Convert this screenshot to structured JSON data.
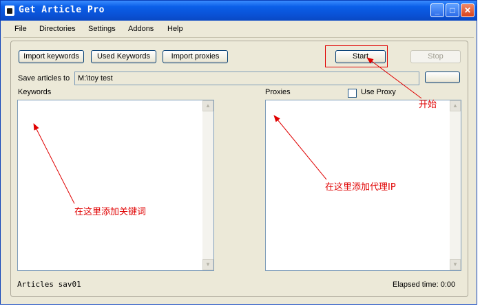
{
  "window": {
    "title": "Get Article Pro"
  },
  "titlebar_buttons": {
    "minimize": "_",
    "maximize": "□",
    "close": "✕"
  },
  "menu": [
    "File",
    "Directories",
    "Settings",
    "Addons",
    "Help"
  ],
  "toolbar": {
    "import_keywords": "Import keywords",
    "used_keywords": "Used Keywords",
    "import_proxies": "Import proxies",
    "start": "Start",
    "stop": "Stop"
  },
  "save": {
    "label": "Save articles to",
    "path": "M:\\toy test",
    "browse_label": ""
  },
  "keywords": {
    "label": "Keywords"
  },
  "proxies": {
    "label": "Proxies",
    "use_proxy_label": "Use Proxy",
    "use_proxy_checked": false
  },
  "scroll": {
    "up": "▲",
    "down": "▼"
  },
  "status": {
    "left": "Articles sav01",
    "elapsed": "Elapsed time: 0:00"
  },
  "annotations": {
    "start_note": "开始",
    "keywords_note": "在这里添加关键词",
    "proxies_note": "在这里添加代理IP",
    "color": "#e00000"
  }
}
